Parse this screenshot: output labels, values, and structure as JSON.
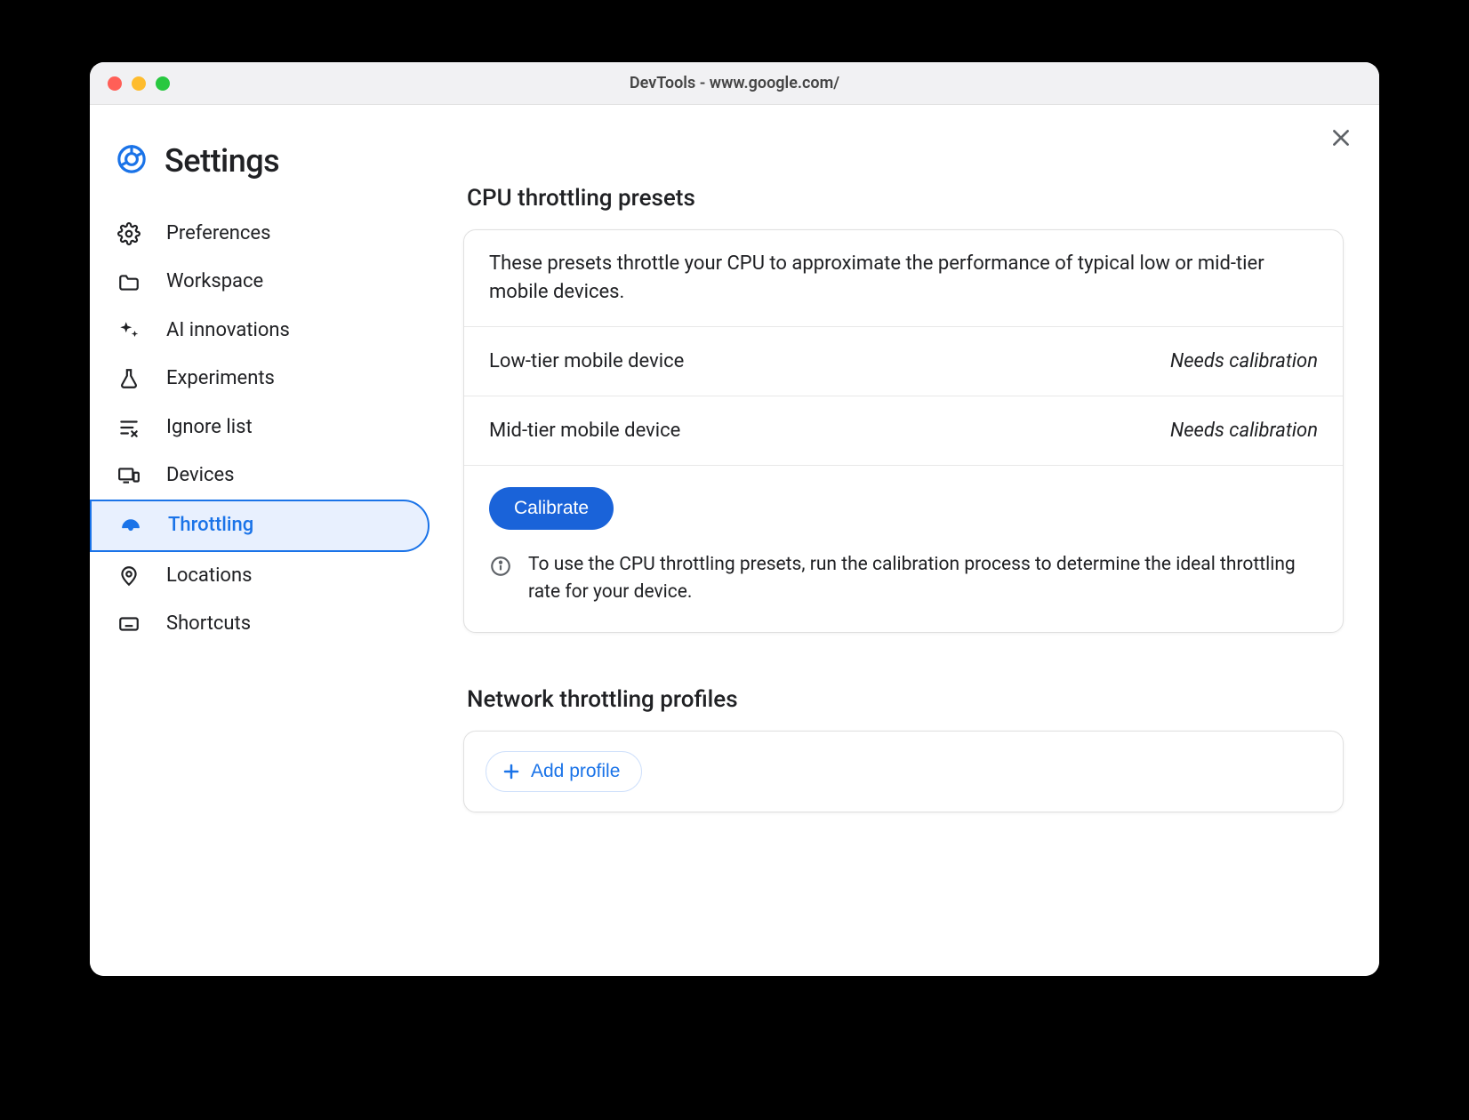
{
  "window_title": "DevTools - www.google.com/",
  "page_title": "Settings",
  "sidebar": {
    "items": [
      {
        "label": "Preferences"
      },
      {
        "label": "Workspace"
      },
      {
        "label": "AI innovations"
      },
      {
        "label": "Experiments"
      },
      {
        "label": "Ignore list"
      },
      {
        "label": "Devices"
      },
      {
        "label": "Throttling"
      },
      {
        "label": "Locations"
      },
      {
        "label": "Shortcuts"
      }
    ]
  },
  "cpu": {
    "section_title": "CPU throttling presets",
    "description": "These presets throttle your CPU to approximate the performance of typical low or mid-tier mobile devices.",
    "presets": [
      {
        "name": "Low-tier mobile device",
        "status": "Needs calibration"
      },
      {
        "name": "Mid-tier mobile device",
        "status": "Needs calibration"
      }
    ],
    "calibrate_label": "Calibrate",
    "info": "To use the CPU throttling presets, run the calibration process to determine the ideal throttling rate for your device."
  },
  "network": {
    "section_title": "Network throttling profiles",
    "add_label": "Add profile"
  }
}
